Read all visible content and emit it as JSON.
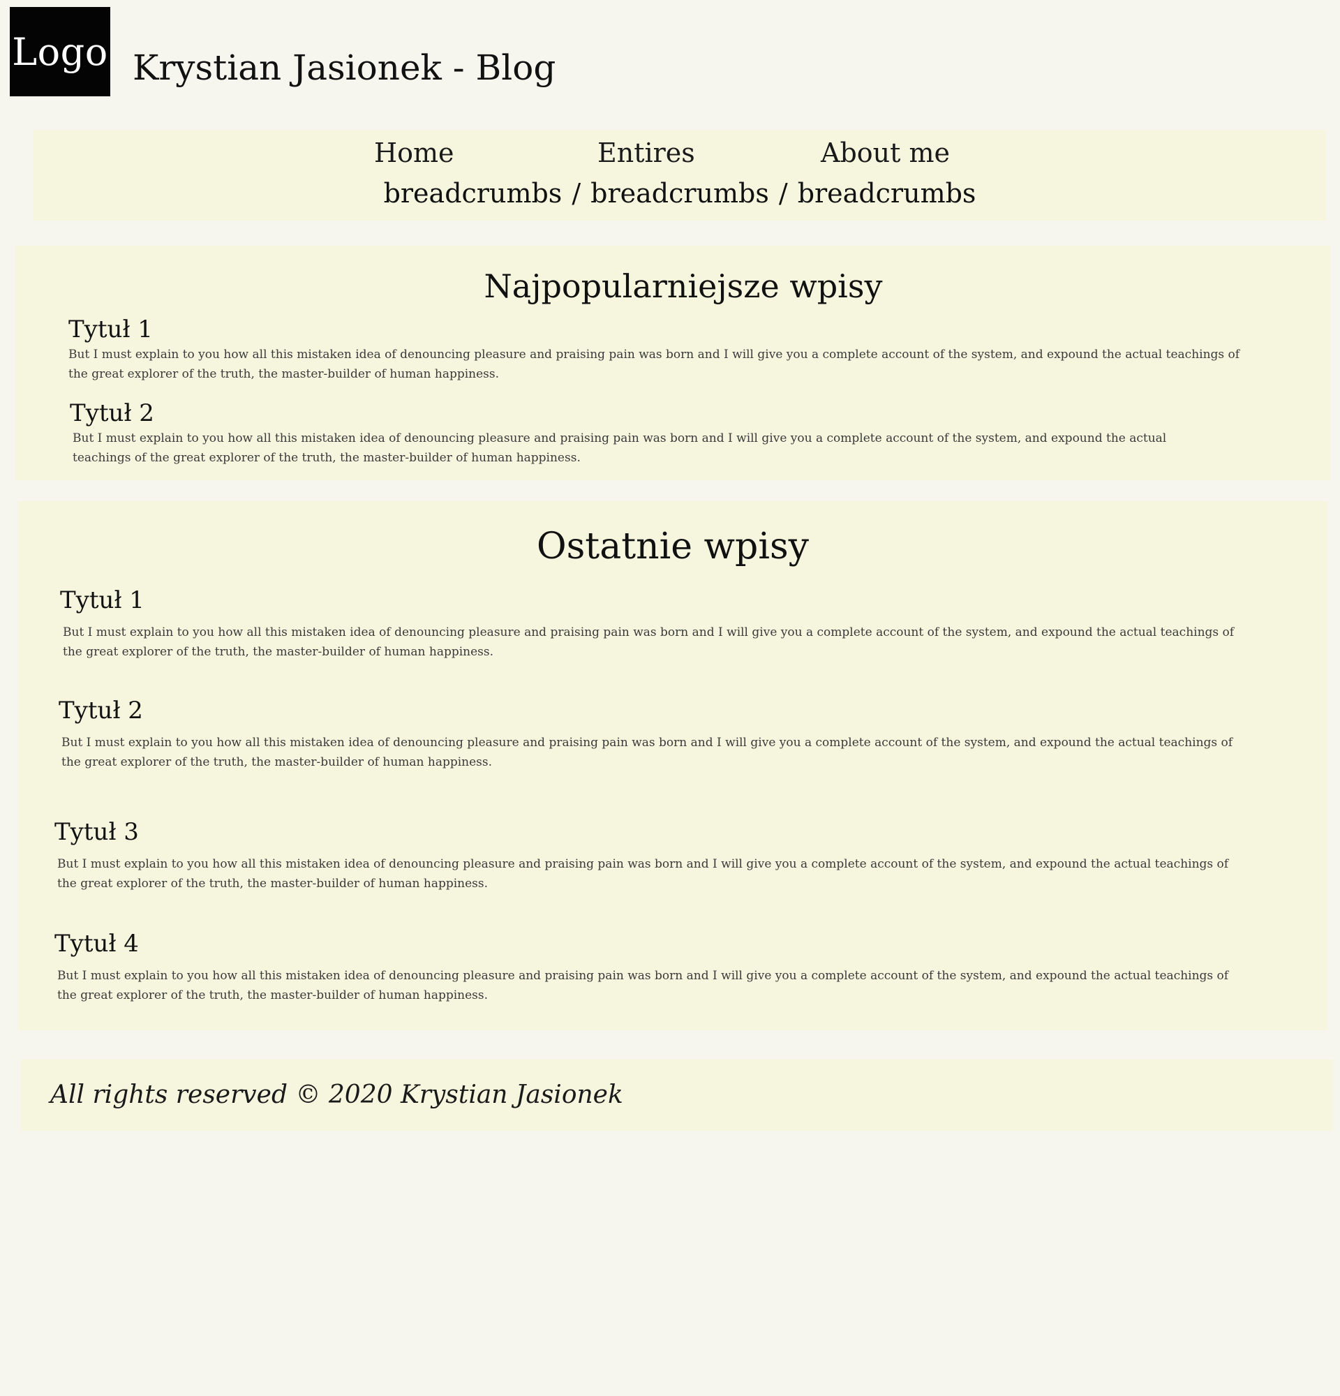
{
  "header": {
    "logo_text": "Logo",
    "title": "Krystian Jasionek - Blog"
  },
  "nav": {
    "items": [
      {
        "label": "Home"
      },
      {
        "label": "Entires"
      },
      {
        "label": "About me"
      }
    ],
    "breadcrumbs": [
      "breadcrumbs",
      "breadcrumbs",
      "breadcrumbs"
    ],
    "breadcrumb_separator": "/"
  },
  "popular": {
    "heading": "Najpopularniejsze wpisy",
    "posts": [
      {
        "title": "Tytuł 1",
        "excerpt": "But I must explain to you how all this mistaken idea of denouncing pleasure and praising pain was born and I will give you a complete account of the system, and expound the actual teachings of the great explorer of the truth, the master-builder of human happiness."
      },
      {
        "title": "Tytuł 2",
        "excerpt": "But I must explain to you how all this mistaken idea of denouncing pleasure and praising pain was born and I will give you a complete account of the system, and expound the actual teachings of the great explorer of the truth, the master-builder of human happiness."
      }
    ]
  },
  "recent": {
    "heading": "Ostatnie wpisy",
    "posts": [
      {
        "title": "Tytuł 1",
        "excerpt": "But I must explain to you how all this mistaken idea of denouncing pleasure and praising pain was born and I will give you a complete account of the system, and expound the actual teachings of the great explorer of the truth, the master-builder of human happiness."
      },
      {
        "title": "Tytuł 2",
        "excerpt": "But I must explain to you how all this mistaken idea of denouncing pleasure and praising pain was born and I will give you a complete account of the system, and expound the actual teachings of the great explorer of the truth, the master-builder of human happiness."
      },
      {
        "title": "Tytuł 3",
        "excerpt": "But I must explain to you how all this mistaken idea of denouncing pleasure and praising pain was born and I will give you a complete account of the system, and expound the actual teachings of the great explorer of the truth, the master-builder of human happiness."
      },
      {
        "title": "Tytuł 4",
        "excerpt": "But I must explain to you how all this mistaken idea of denouncing pleasure and praising pain was born and I will give you a complete account of the system, and expound the actual teachings of the great explorer of the truth, the master-builder of human happiness."
      }
    ]
  },
  "footer": {
    "text": "All rights reserved © 2020 Krystian Jasionek"
  },
  "colors": {
    "page_background": "#f6f6ef",
    "panel_background": "#f6f6df",
    "logo_background": "#040404",
    "text": "#111111",
    "excerpt_text": "#3a3a3a"
  }
}
